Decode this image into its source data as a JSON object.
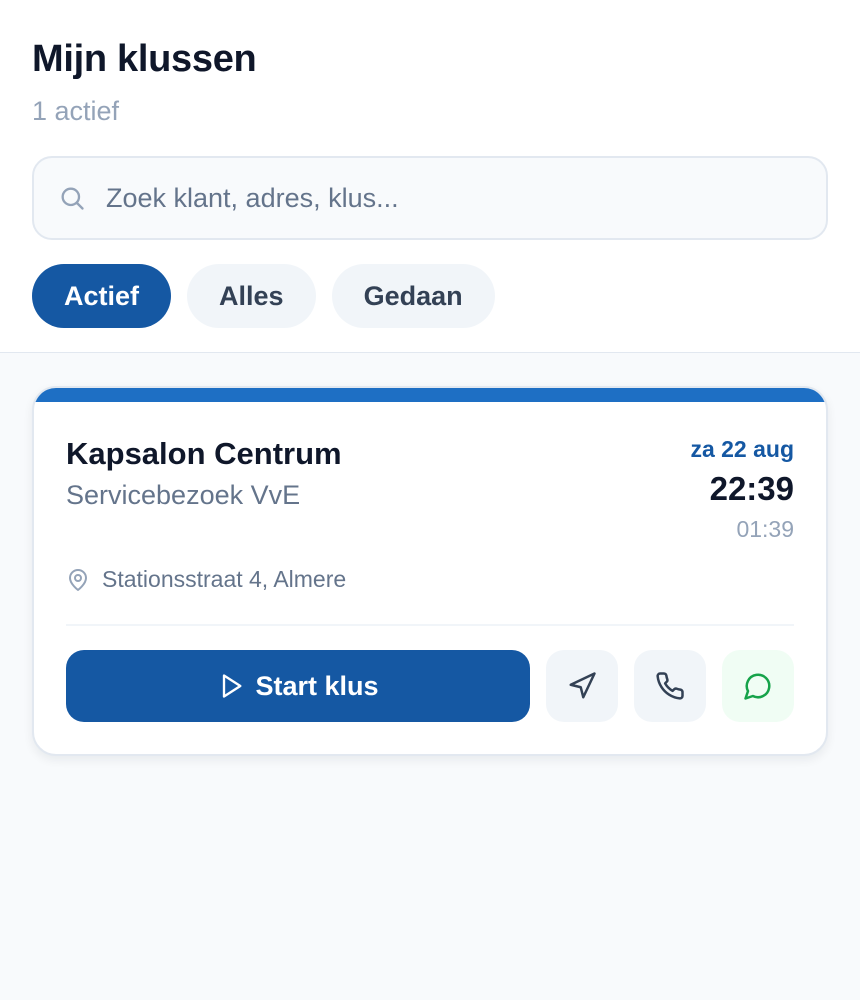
{
  "header": {
    "title": "Mijn klussen",
    "subtitle": "1 actief"
  },
  "search": {
    "placeholder": "Zoek klant, adres, klus...",
    "value": "",
    "icon": "search-icon"
  },
  "tabs": [
    {
      "label": "Actief",
      "active": true
    },
    {
      "label": "Alles",
      "active": false
    },
    {
      "label": "Gedaan",
      "active": false
    }
  ],
  "job": {
    "client": "Kapsalon Centrum",
    "service": "Servicebezoek VvE",
    "date": "za 22 aug",
    "start_time": "22:39",
    "end_time": "01:39",
    "address": "Stationsstraat 4, Almere",
    "start_label": "Start klus",
    "icons": [
      "map-pin-icon",
      "play-icon",
      "navigation-icon",
      "phone-icon",
      "message-circle-icon"
    ]
  },
  "colors": {
    "primary": "#1558a3",
    "accent_bar": "#1e6fc4",
    "whatsapp": "#16a34a"
  }
}
